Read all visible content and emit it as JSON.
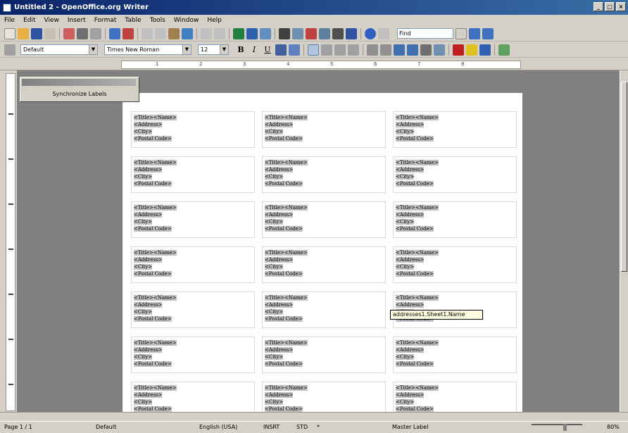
{
  "window": {
    "title": "Untitled 2 - OpenOffice.org Writer"
  },
  "menubar": [
    "File",
    "Edit",
    "View",
    "Insert",
    "Format",
    "Table",
    "Tools",
    "Window",
    "Help"
  ],
  "toolbar": {
    "find_value": "Find"
  },
  "formatting": {
    "style": "Default",
    "font": "Times New Roman",
    "size": "12",
    "bold": "B",
    "italic": "I",
    "underline": "U"
  },
  "ruler": [
    "1",
    "2",
    "3",
    "4",
    "5",
    "6",
    "7",
    "8"
  ],
  "float_window": {
    "button_label": "Synchronize Labels"
  },
  "label": {
    "line1": "<Title><Name>",
    "line2": "<Address>",
    "line3": "<City>",
    "line4": "<Postal Code>"
  },
  "tooltip": "addresses1.Sheet1.Name",
  "status": {
    "page": "Page 1 / 1",
    "style": "Default",
    "language": "English (USA)",
    "mode": "INSRT",
    "selection": "STD",
    "modified": "*",
    "master": "Master Label",
    "zoom": "80%"
  }
}
